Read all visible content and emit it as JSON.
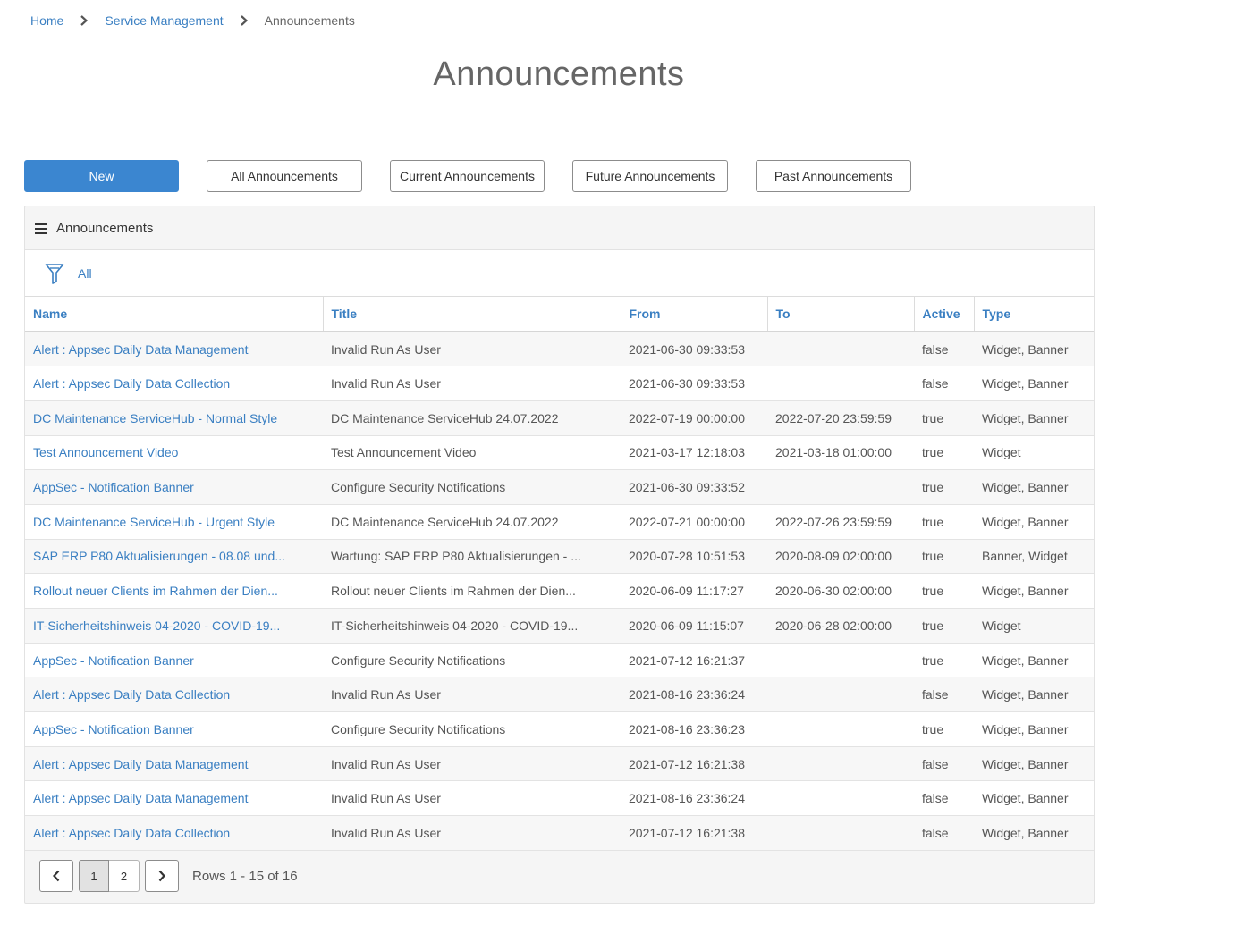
{
  "breadcrumb": {
    "items": [
      "Home",
      "Service Management"
    ],
    "current": "Announcements"
  },
  "page": {
    "title": "Announcements"
  },
  "toolbar": {
    "new_label": "New",
    "filters": [
      "All Announcements",
      "Current Announcements",
      "Future Announcements",
      "Past Announcements"
    ]
  },
  "panel": {
    "title": "Announcements",
    "filter_label": "All"
  },
  "table": {
    "columns": [
      "Name",
      "Title",
      "From",
      "To",
      "Active",
      "Type"
    ],
    "rows": [
      [
        "Alert : Appsec Daily Data Management",
        "Invalid Run As User",
        "2021-06-30 09:33:53",
        "",
        "false",
        "Widget, Banner"
      ],
      [
        "Alert : Appsec Daily Data Collection",
        "Invalid Run As User",
        "2021-06-30 09:33:53",
        "",
        "false",
        "Widget, Banner"
      ],
      [
        "DC Maintenance ServiceHub - Normal Style",
        "DC Maintenance ServiceHub 24.07.2022",
        "2022-07-19 00:00:00",
        "2022-07-20 23:59:59",
        "true",
        "Widget, Banner"
      ],
      [
        "Test Announcement Video",
        "Test Announcement Video",
        "2021-03-17 12:18:03",
        "2021-03-18 01:00:00",
        "true",
        "Widget"
      ],
      [
        "AppSec - Notification Banner",
        "Configure Security Notifications",
        "2021-06-30 09:33:52",
        "",
        "true",
        "Widget, Banner"
      ],
      [
        "DC Maintenance ServiceHub - Urgent Style",
        "DC Maintenance ServiceHub 24.07.2022",
        "2022-07-21 00:00:00",
        "2022-07-26 23:59:59",
        "true",
        "Widget, Banner"
      ],
      [
        "SAP ERP P80 Aktualisierungen - 08.08 und...",
        "Wartung: SAP ERP P80 Aktualisierungen - ...",
        "2020-07-28 10:51:53",
        "2020-08-09 02:00:00",
        "true",
        "Banner, Widget"
      ],
      [
        "Rollout neuer Clients im Rahmen der Dien...",
        "Rollout neuer Clients im Rahmen der Dien...",
        "2020-06-09 11:17:27",
        "2020-06-30 02:00:00",
        "true",
        "Widget, Banner"
      ],
      [
        "IT-Sicherheitshinweis 04-2020 - COVID-19...",
        "IT-Sicherheitshinweis 04-2020 - COVID-19...",
        "2020-06-09 11:15:07",
        "2020-06-28 02:00:00",
        "true",
        "Widget"
      ],
      [
        "AppSec - Notification Banner",
        "Configure Security Notifications",
        "2021-07-12 16:21:37",
        "",
        "true",
        "Widget, Banner"
      ],
      [
        "Alert : Appsec Daily Data Collection",
        "Invalid Run As User",
        "2021-08-16 23:36:24",
        "",
        "false",
        "Widget, Banner"
      ],
      [
        "AppSec - Notification Banner",
        "Configure Security Notifications",
        "2021-08-16 23:36:23",
        "",
        "true",
        "Widget, Banner"
      ],
      [
        "Alert : Appsec Daily Data Management",
        "Invalid Run As User",
        "2021-07-12 16:21:38",
        "",
        "false",
        "Widget, Banner"
      ],
      [
        "Alert : Appsec Daily Data Management",
        "Invalid Run As User",
        "2021-08-16 23:36:24",
        "",
        "false",
        "Widget, Banner"
      ],
      [
        "Alert : Appsec Daily Data Collection",
        "Invalid Run As User",
        "2021-07-12 16:21:38",
        "",
        "false",
        "Widget, Banner"
      ]
    ]
  },
  "pagination": {
    "pages": [
      "1",
      "2"
    ],
    "current_page": "1",
    "rows_info": "Rows 1 - 15 of 16"
  },
  "icons": {
    "separator": "chevron-right-icon",
    "panel": "menu-icon",
    "filter": "filter-icon",
    "prev": "chevron-left-icon",
    "next": "chevron-right-icon"
  },
  "colors": {
    "link": "#3a7fc2",
    "primary_button": "#3b86d0",
    "panel_bg": "#f5f5f5"
  }
}
